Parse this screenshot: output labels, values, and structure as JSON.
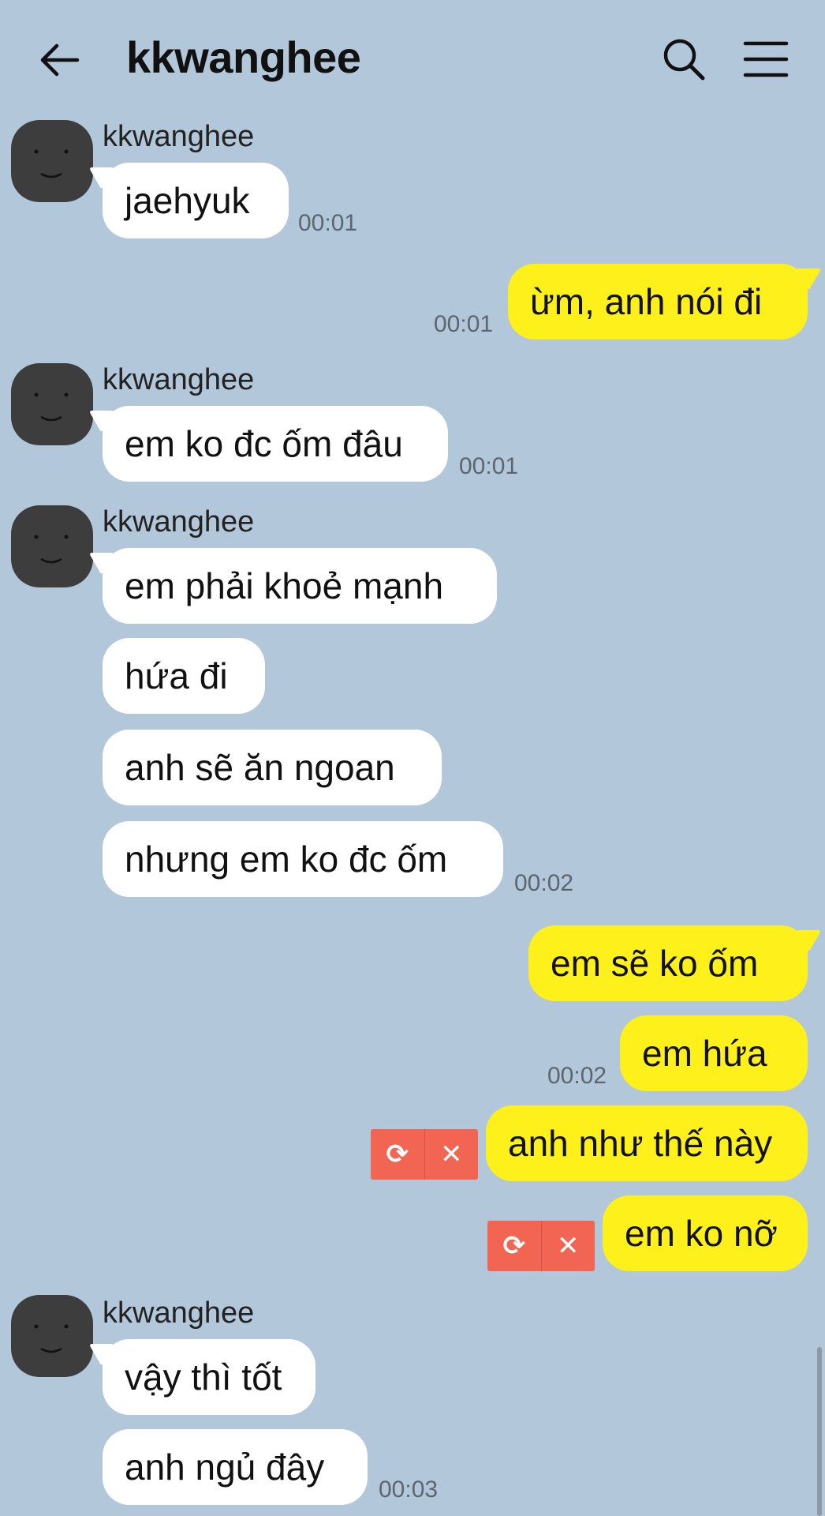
{
  "header": {
    "title": "kkwanghee"
  },
  "messages": {
    "m1": {
      "sender": "kkwanghee",
      "text": "jaehyuk",
      "time": "00:01"
    },
    "m2": {
      "text": "ừm, anh nói đi",
      "time": "00:01"
    },
    "m3": {
      "sender": "kkwanghee",
      "text": "em ko đc ốm đâu",
      "time": "00:01"
    },
    "m4": {
      "sender": "kkwanghee",
      "lines": [
        "em phải khoẻ mạnh",
        "hứa đi",
        "anh sẽ ăn ngoan",
        "nhưng em ko đc ốm"
      ],
      "time": "00:02"
    },
    "m5": {
      "lines": [
        "em sẽ ko ốm",
        "em hứa"
      ],
      "time": "00:02"
    },
    "m6": {
      "text": "anh như thế này",
      "status": "failed"
    },
    "m7": {
      "text": "em ko nỡ",
      "status": "failed"
    },
    "m8": {
      "sender": "kkwanghee",
      "lines": [
        "vậy thì tốt",
        "anh ngủ đây"
      ],
      "time": "00:03"
    }
  },
  "failed_actions": {
    "retry": "⟳",
    "delete": "✕"
  },
  "icons": {
    "back": "arrow-left",
    "search": "magnifier",
    "menu": "hamburger",
    "avatar": "face"
  },
  "colors": {
    "background": "#b2c7d9",
    "incoming_bubble": "#ffffff",
    "outgoing_bubble": "#fef01b",
    "failed_badge": "#f26552"
  }
}
